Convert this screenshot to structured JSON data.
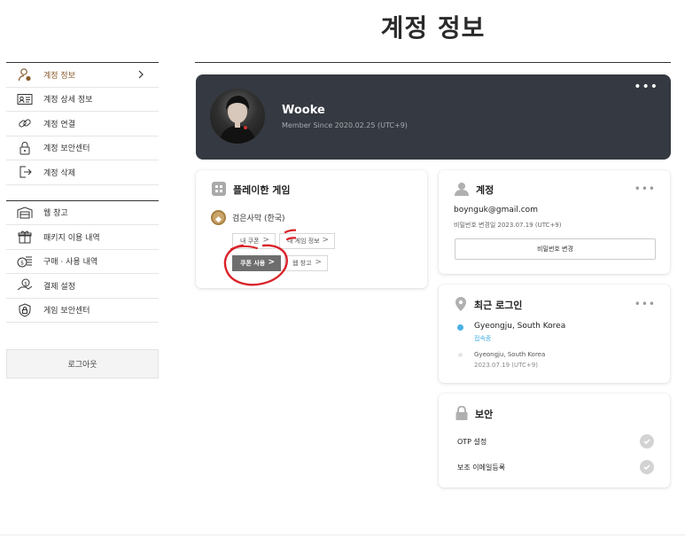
{
  "page": {
    "title": "계정 정보"
  },
  "sidebar": {
    "group1": [
      {
        "label": "계정 정보",
        "icon": "user-settings-icon",
        "active": true
      },
      {
        "label": "계정 상세 정보",
        "icon": "id-card-icon"
      },
      {
        "label": "계정 연결",
        "icon": "link-icon"
      },
      {
        "label": "계정 보안센터",
        "icon": "lock-icon"
      },
      {
        "label": "계정 삭제",
        "icon": "exit-icon"
      }
    ],
    "group2": [
      {
        "label": "웹 창고",
        "icon": "warehouse-icon"
      },
      {
        "label": "패키지 이용 내역",
        "icon": "gift-icon"
      },
      {
        "label": "구매 · 사용 내역",
        "icon": "coins-icon"
      },
      {
        "label": "결제 설정",
        "icon": "payment-hand-icon"
      },
      {
        "label": "게임 보안센터",
        "icon": "shield-lock-icon"
      }
    ],
    "logout_label": "로그아웃"
  },
  "profile": {
    "name": "Wooke",
    "since": "Member Since 2020.02.25 (UTC+9)",
    "more": "•••"
  },
  "games": {
    "title": "플레이한 게임",
    "game_name": "검은사막 (한국)",
    "buttons": {
      "my_coupon": "내 쿠폰",
      "my_game_info": "내 게임 정보",
      "coupon_use": "쿠폰 사용",
      "web_storage": "웹 창고"
    },
    "chevron": ">"
  },
  "account": {
    "title": "계정",
    "email": "boynguk@gmail.com",
    "pw_changed": "비밀번호 변경일 2023.07.19 (UTC+9)",
    "change_pw_button": "비밀번호 변경",
    "more": "•••"
  },
  "recent_login": {
    "title": "최근 로그인",
    "more": "•••",
    "entries": [
      {
        "location": "Gyeongju, South Korea",
        "status": "접속중"
      },
      {
        "location": "Gyeongju, South Korea",
        "time": "2023.07.19 (UTC+9)"
      }
    ]
  },
  "security": {
    "title": "보안",
    "items": [
      {
        "label": "OTP 설정"
      },
      {
        "label": "보조 이메일등록"
      }
    ]
  },
  "colors": {
    "accent": "#8a5a2b",
    "card_dark": "#353941",
    "online": "#4ab0e6",
    "annotation": "#d9232a"
  }
}
